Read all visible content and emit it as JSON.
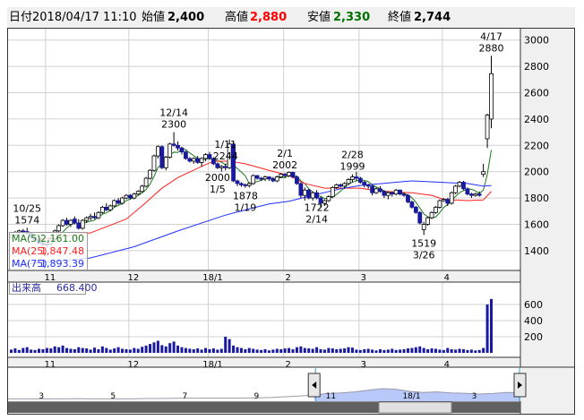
{
  "header": {
    "date_label": "日付",
    "date": "2018/04/17 11:10",
    "open_label": "始値",
    "open": "2,400",
    "high_label": "高値",
    "high": "2,880",
    "low_label": "安値",
    "low": "2,330",
    "close_label": "終値",
    "close": "2,744"
  },
  "colors": {
    "up_fill": "#ffffff",
    "down_fill": "#1a1aa0",
    "ma5": "#1a7a1a",
    "ma25": "#ff2020",
    "ma75": "#2030ff",
    "high": "#ff0000",
    "low": "#007000",
    "volume": "#1a1aa0",
    "nav_fill": "#b8c8f8"
  },
  "legend": {
    "ma5_label": "MA(5)",
    "ma5": "2,161.00",
    "ma25_label": "MA(25)",
    "ma25": "1,847.48",
    "ma75_label": "MA(75)",
    "ma75": "1,893.39"
  },
  "volume_label": {
    "label": "出来高",
    "value": "668.400"
  },
  "chart_data": {
    "type": "candlestick",
    "y_ticks": [
      3000,
      2800,
      2600,
      2400,
      2200,
      2000,
      1800,
      1600,
      1400
    ],
    "ylim": [
      1270,
      3020
    ],
    "month_labels": [
      {
        "label": "11",
        "index": 9
      },
      {
        "label": "12",
        "index": 30
      },
      {
        "label": "18/1",
        "index": 50
      },
      {
        "label": "2",
        "index": 69
      },
      {
        "label": "3",
        "index": 88
      },
      {
        "label": "4",
        "index": 109
      }
    ],
    "ohlc": [
      [
        1500,
        1530,
        1490,
        1520
      ],
      [
        1520,
        1550,
        1510,
        1540
      ],
      [
        1540,
        1560,
        1525,
        1550
      ],
      [
        1550,
        1565,
        1530,
        1545
      ],
      [
        1545,
        1574,
        1520,
        1530
      ],
      [
        1530,
        1540,
        1490,
        1500
      ],
      [
        1500,
        1510,
        1470,
        1480
      ],
      [
        1480,
        1495,
        1450,
        1460
      ],
      [
        1460,
        1470,
        1430,
        1445
      ],
      [
        1445,
        1460,
        1423,
        1450
      ],
      [
        1450,
        1500,
        1440,
        1490
      ],
      [
        1490,
        1560,
        1480,
        1550
      ],
      [
        1550,
        1600,
        1540,
        1590
      ],
      [
        1590,
        1640,
        1580,
        1630
      ],
      [
        1630,
        1650,
        1590,
        1600
      ],
      [
        1600,
        1640,
        1580,
        1630
      ],
      [
        1640,
        1660,
        1600,
        1610
      ],
      [
        1610,
        1640,
        1560,
        1570
      ],
      [
        1570,
        1640,
        1560,
        1630
      ],
      [
        1630,
        1660,
        1610,
        1650
      ],
      [
        1650,
        1680,
        1630,
        1660
      ],
      [
        1660,
        1690,
        1640,
        1650
      ],
      [
        1650,
        1700,
        1640,
        1690
      ],
      [
        1690,
        1740,
        1680,
        1730
      ],
      [
        1730,
        1760,
        1700,
        1710
      ],
      [
        1710,
        1750,
        1700,
        1740
      ],
      [
        1740,
        1790,
        1730,
        1780
      ],
      [
        1780,
        1800,
        1750,
        1760
      ],
      [
        1760,
        1810,
        1750,
        1800
      ],
      [
        1800,
        1830,
        1790,
        1820
      ],
      [
        1820,
        1830,
        1790,
        1800
      ],
      [
        1800,
        1840,
        1790,
        1830
      ],
      [
        1830,
        1860,
        1820,
        1850
      ],
      [
        1850,
        1900,
        1840,
        1890
      ],
      [
        1890,
        1960,
        1880,
        1950
      ],
      [
        1950,
        2020,
        1940,
        2010
      ],
      [
        2010,
        2130,
        2000,
        2120
      ],
      [
        2120,
        2200,
        2100,
        2190
      ],
      [
        2190,
        2200,
        2020,
        2030
      ],
      [
        2030,
        2120,
        2010,
        2110
      ],
      [
        2110,
        2220,
        2100,
        2210
      ],
      [
        2210,
        2300,
        2190,
        2200
      ],
      [
        2200,
        2230,
        2160,
        2180
      ],
      [
        2180,
        2190,
        2130,
        2150
      ],
      [
        2150,
        2160,
        2090,
        2100
      ],
      [
        2100,
        2110,
        2070,
        2080
      ],
      [
        2080,
        2110,
        2060,
        2100
      ],
      [
        2100,
        2120,
        2060,
        2070
      ],
      [
        2070,
        2110,
        2040,
        2100
      ],
      [
        2100,
        2140,
        2080,
        2130
      ],
      [
        2130,
        2150,
        2090,
        2100
      ],
      [
        2100,
        2110,
        2050,
        2060
      ],
      [
        2060,
        2070,
        2020,
        2030
      ],
      [
        2030,
        2050,
        2000,
        2040
      ],
      [
        2040,
        2060,
        2010,
        2030
      ],
      [
        2030,
        2244,
        2020,
        2210
      ],
      [
        2210,
        2230,
        1920,
        1930
      ],
      [
        1930,
        1940,
        1890,
        1910
      ],
      [
        1910,
        1920,
        1885,
        1900
      ],
      [
        1900,
        1910,
        1878,
        1895
      ],
      [
        1895,
        1920,
        1880,
        1910
      ],
      [
        1910,
        1980,
        1900,
        1970
      ],
      [
        1970,
        1975,
        1940,
        1950
      ],
      [
        1950,
        1960,
        1930,
        1945
      ],
      [
        1945,
        1970,
        1930,
        1960
      ],
      [
        1960,
        1965,
        1930,
        1945
      ],
      [
        1945,
        1960,
        1920,
        1930
      ],
      [
        1930,
        1970,
        1920,
        1960
      ],
      [
        1960,
        1990,
        1950,
        1980
      ],
      [
        1980,
        1990,
        1950,
        1970
      ],
      [
        1970,
        2002,
        1960,
        1995
      ],
      [
        1995,
        2000,
        1950,
        1960
      ],
      [
        1960,
        1970,
        1900,
        1910
      ],
      [
        1910,
        1920,
        1800,
        1820
      ],
      [
        1820,
        1880,
        1780,
        1860
      ],
      [
        1860,
        1870,
        1790,
        1800
      ],
      [
        1800,
        1850,
        1780,
        1840
      ],
      [
        1840,
        1860,
        1790,
        1800
      ],
      [
        1800,
        1810,
        1722,
        1760
      ],
      [
        1760,
        1790,
        1740,
        1780
      ],
      [
        1780,
        1820,
        1770,
        1810
      ],
      [
        1810,
        1890,
        1800,
        1880
      ],
      [
        1880,
        1910,
        1870,
        1900
      ],
      [
        1900,
        1910,
        1880,
        1890
      ],
      [
        1890,
        1920,
        1870,
        1910
      ],
      [
        1910,
        1950,
        1900,
        1940
      ],
      [
        1940,
        1980,
        1920,
        1960
      ],
      [
        1960,
        1999,
        1930,
        1950
      ],
      [
        1950,
        1960,
        1910,
        1920
      ],
      [
        1920,
        1930,
        1880,
        1900
      ],
      [
        1900,
        1910,
        1870,
        1890
      ],
      [
        1890,
        1900,
        1820,
        1840
      ],
      [
        1840,
        1880,
        1830,
        1870
      ],
      [
        1870,
        1890,
        1840,
        1850
      ],
      [
        1850,
        1860,
        1800,
        1820
      ],
      [
        1820,
        1850,
        1790,
        1840
      ],
      [
        1840,
        1850,
        1810,
        1830
      ],
      [
        1830,
        1870,
        1820,
        1860
      ],
      [
        1860,
        1865,
        1820,
        1830
      ],
      [
        1830,
        1840,
        1810,
        1820
      ],
      [
        1820,
        1830,
        1760,
        1770
      ],
      [
        1770,
        1780,
        1720,
        1730
      ],
      [
        1730,
        1740,
        1680,
        1690
      ],
      [
        1690,
        1700,
        1600,
        1610
      ],
      [
        1560,
        1620,
        1519,
        1600
      ],
      [
        1600,
        1660,
        1590,
        1650
      ],
      [
        1650,
        1700,
        1640,
        1690
      ],
      [
        1690,
        1740,
        1680,
        1730
      ],
      [
        1730,
        1790,
        1720,
        1780
      ],
      [
        1780,
        1800,
        1770,
        1790
      ],
      [
        1790,
        1800,
        1740,
        1760
      ],
      [
        1760,
        1850,
        1750,
        1840
      ],
      [
        1840,
        1900,
        1830,
        1890
      ],
      [
        1890,
        1930,
        1880,
        1920
      ],
      [
        1920,
        1930,
        1860,
        1870
      ],
      [
        1870,
        1880,
        1820,
        1830
      ],
      [
        1830,
        1840,
        1800,
        1820
      ],
      [
        1820,
        1840,
        1810,
        1830
      ],
      [
        1830,
        1850,
        1810,
        1820
      ],
      [
        1980,
        2060,
        1960,
        2000
      ],
      [
        2250,
        2440,
        2180,
        2430
      ],
      [
        2400,
        2880,
        2330,
        2744
      ]
    ],
    "ma25": [
      [
        6,
        1480
      ],
      [
        20,
        1535
      ],
      [
        29,
        1640
      ],
      [
        33,
        1740
      ],
      [
        38,
        1875
      ],
      [
        42,
        1955
      ],
      [
        48,
        2040
      ],
      [
        51,
        2080
      ],
      [
        55,
        2080
      ],
      [
        59,
        2060
      ],
      [
        65,
        2010
      ],
      [
        70,
        1970
      ],
      [
        74,
        1910
      ],
      [
        79,
        1875
      ],
      [
        83,
        1875
      ],
      [
        88,
        1875
      ],
      [
        92,
        1855
      ],
      [
        97,
        1845
      ],
      [
        101,
        1840
      ],
      [
        106,
        1820
      ],
      [
        109,
        1790
      ],
      [
        115,
        1780
      ],
      [
        119,
        1785
      ],
      [
        121,
        1850
      ]
    ],
    "ma75": [
      [
        0,
        1290
      ],
      [
        20,
        1345
      ],
      [
        31,
        1430
      ],
      [
        42,
        1550
      ],
      [
        54,
        1670
      ],
      [
        61,
        1725
      ],
      [
        65,
        1755
      ],
      [
        70,
        1775
      ],
      [
        76,
        1820
      ],
      [
        83,
        1870
      ],
      [
        88,
        1895
      ],
      [
        97,
        1920
      ],
      [
        101,
        1930
      ],
      [
        108,
        1920
      ],
      [
        115,
        1910
      ],
      [
        119,
        1890
      ],
      [
        121,
        1895
      ]
    ],
    "annotations": [
      {
        "index": 4,
        "date": "10/25",
        "value": "1574",
        "type": "high"
      },
      {
        "index": 41,
        "date": "12/14",
        "value": "2300",
        "type": "high"
      },
      {
        "index": 54,
        "date": "1/11",
        "value": "2244",
        "type": "high"
      },
      {
        "index": 52,
        "date": "1/5",
        "value": "2000",
        "type": "low"
      },
      {
        "index": 59,
        "date": "1/19",
        "value": "1878",
        "type": "low"
      },
      {
        "index": 69,
        "date": "2/1",
        "value": "2002",
        "type": "high"
      },
      {
        "index": 77,
        "date": "2/14",
        "value": "1722",
        "type": "low"
      },
      {
        "index": 86,
        "date": "2/28",
        "value": "1999",
        "type": "high"
      },
      {
        "index": 104,
        "date": "3/26",
        "value": "1519",
        "type": "low"
      },
      {
        "index": 121,
        "date": "4/17",
        "value": "2880",
        "type": "high"
      }
    ],
    "volume": {
      "y_ticks": [
        600,
        400,
        200
      ],
      "ylim": [
        0,
        700
      ],
      "values": [
        40,
        55,
        35,
        60,
        70,
        40,
        35,
        50,
        45,
        60,
        55,
        80,
        70,
        90,
        60,
        50,
        45,
        70,
        60,
        55,
        40,
        65,
        45,
        80,
        60,
        40,
        55,
        70,
        50,
        45,
        40,
        60,
        50,
        75,
        90,
        110,
        130,
        150,
        95,
        80,
        120,
        140,
        90,
        70,
        60,
        50,
        45,
        55,
        40,
        60,
        45,
        55,
        40,
        50,
        200,
        170,
        90,
        70,
        60,
        45,
        60,
        50,
        40,
        35,
        45,
        30,
        40,
        50,
        45,
        55,
        60,
        45,
        70,
        80,
        60,
        55,
        50,
        70,
        45,
        40,
        60,
        55,
        45,
        50,
        55,
        70,
        65,
        40,
        35,
        45,
        50,
        40,
        30,
        45,
        35,
        40,
        50,
        35,
        40,
        45,
        55,
        60,
        70,
        80,
        60,
        45,
        55,
        50,
        40,
        35,
        60,
        45,
        40,
        50,
        45,
        35,
        40,
        30,
        35,
        60,
        600,
        668.4
      ]
    },
    "navigator": {
      "labels": [
        {
          "label": "3",
          "pos": 0.06
        },
        {
          "label": "5",
          "pos": 0.2
        },
        {
          "label": "7",
          "pos": 0.34
        },
        {
          "label": "9",
          "pos": 0.48
        },
        {
          "label": "11",
          "pos": 0.62
        },
        {
          "label": "18/1",
          "pos": 0.77
        },
        {
          "label": "3",
          "pos": 0.905
        }
      ],
      "series": [
        1300,
        1300,
        1300,
        1300,
        1300,
        1320,
        1300,
        1300,
        1300,
        1300,
        1330,
        1330,
        1350,
        1360,
        1360,
        1370,
        1380,
        1380,
        1400,
        1430,
        1500,
        1560,
        1650,
        1800,
        1850,
        1950,
        2100,
        2250,
        2200,
        2000,
        1900,
        1950,
        1850,
        1820,
        1750,
        1800,
        1900,
        1850
      ],
      "selection": [
        0.6,
        1.0
      ]
    }
  }
}
